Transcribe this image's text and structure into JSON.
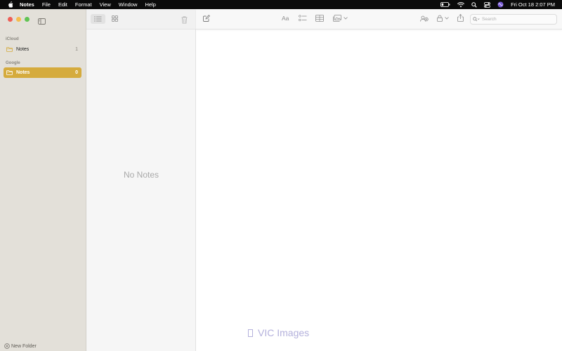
{
  "menubar": {
    "app_name": "Notes",
    "items": [
      "File",
      "Edit",
      "Format",
      "View",
      "Window",
      "Help"
    ],
    "clock": "Fri Oct 18  2:07 PM"
  },
  "sidebar": {
    "sections": [
      {
        "label": "iCloud",
        "folders": [
          {
            "name": "Notes",
            "count": "1",
            "selected": false
          }
        ]
      },
      {
        "label": "Google",
        "folders": [
          {
            "name": "Notes",
            "count": "0",
            "selected": true
          }
        ]
      }
    ],
    "new_folder_label": "New Folder"
  },
  "list": {
    "empty_text": "No Notes"
  },
  "toolbar": {
    "format_label": "Aa",
    "search_placeholder": "Search"
  },
  "watermark": {
    "text": "VIC Images"
  },
  "colors": {
    "accent_selected": "#d5ab3d",
    "sidebar_bg": "#e3e0d9",
    "close": "#ee5f57",
    "minimize": "#f5bd4f",
    "maximize": "#61c454"
  },
  "icons": {
    "apple": "apple-icon",
    "battery": "battery-icon",
    "wifi": "wifi-icon",
    "spotlight": "search-icon",
    "control_center": "control-center-icon",
    "siri": "siri-icon",
    "sidebar_toggle": "sidebar-toggle-icon",
    "folder": "folder-icon",
    "list_view": "list-view-icon",
    "gallery_view": "gallery-view-icon",
    "trash": "trash-icon",
    "compose": "compose-icon",
    "checklist": "checklist-icon",
    "table": "table-icon",
    "media": "media-icon",
    "collaborate": "collaborate-icon",
    "lock": "lock-icon",
    "share": "share-icon"
  }
}
